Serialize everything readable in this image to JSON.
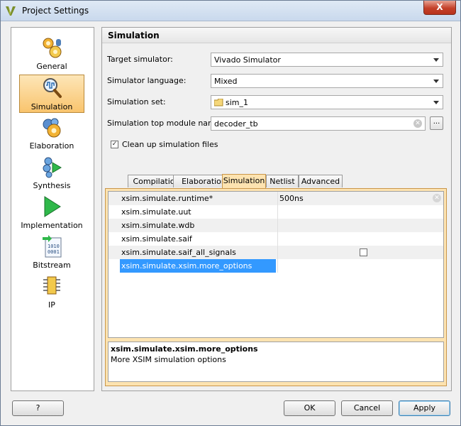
{
  "window": {
    "title": "Project Settings",
    "close_label": "X"
  },
  "sidebar": {
    "items": [
      {
        "label": "General",
        "icon": "gears-icon",
        "selected": false
      },
      {
        "label": "Simulation",
        "icon": "waveform-magnifier-icon",
        "selected": true
      },
      {
        "label": "Elaboration",
        "icon": "gear-icon",
        "selected": false
      },
      {
        "label": "Synthesis",
        "icon": "synthesis-icon",
        "selected": false
      },
      {
        "label": "Implementation",
        "icon": "play-arrow-icon",
        "selected": false
      },
      {
        "label": "Bitstream",
        "icon": "bitstream-icon",
        "selected": false
      },
      {
        "label": "IP",
        "icon": "chip-icon",
        "selected": false
      }
    ]
  },
  "main": {
    "title": "Simulation",
    "target_simulator": {
      "label": "Target simulator:",
      "value": "Vivado Simulator"
    },
    "simulator_language": {
      "label": "Simulator language:",
      "value": "Mixed"
    },
    "simulation_set": {
      "label": "Simulation set:",
      "value": "sim_1"
    },
    "top_module": {
      "label": "Simulation top module name:",
      "value": "decoder_tb",
      "browse_label": "..."
    },
    "cleanup": {
      "label": "Clean up simulation files",
      "checked": true
    },
    "tabs": [
      {
        "label": "Compilation",
        "active": false
      },
      {
        "label": "Elaboration",
        "active": false
      },
      {
        "label": "Simulation",
        "active": true
      },
      {
        "label": "Netlist",
        "active": false
      },
      {
        "label": "Advanced",
        "active": false
      }
    ],
    "properties": [
      {
        "name": "xsim.simulate.runtime*",
        "value": "500ns"
      },
      {
        "name": "xsim.simulate.uut",
        "value": ""
      },
      {
        "name": "xsim.simulate.wdb",
        "value": ""
      },
      {
        "name": "xsim.simulate.saif",
        "value": ""
      },
      {
        "name": "xsim.simulate.saif_all_signals",
        "value": "",
        "checkbox": false
      },
      {
        "name": "xsim.simulate.xsim.more_options",
        "value": "",
        "selected": true
      }
    ],
    "description": {
      "title": "xsim.simulate.xsim.more_options",
      "text": "More XSIM simulation options"
    }
  },
  "footer": {
    "help_label": "?",
    "ok_label": "OK",
    "cancel_label": "Cancel",
    "apply_label": "Apply"
  },
  "colors": {
    "selection": "#3399ff",
    "accent": "#f9c46d",
    "tab_frame": "#fde3b0"
  }
}
